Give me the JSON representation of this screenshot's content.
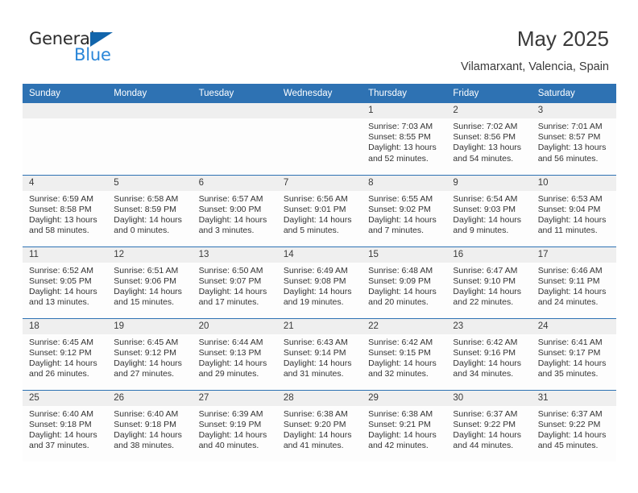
{
  "brand": {
    "name_top": "General",
    "name_bottom": "Blue",
    "triangle_color": "#1265ab",
    "blue_text_color": "#2a86d8"
  },
  "header": {
    "month_title": "May 2025",
    "location": "Vilamarxant, Valencia, Spain"
  },
  "theme": {
    "header_bar_color": "#2e72b3",
    "daynum_band_color": "#efefef",
    "row_divider_color": "#2e72b3"
  },
  "weekday_headers": [
    "Sunday",
    "Monday",
    "Tuesday",
    "Wednesday",
    "Thursday",
    "Friday",
    "Saturday"
  ],
  "weeks": [
    [
      {
        "day": "",
        "sunrise": "",
        "sunset": "",
        "daylight1": "",
        "daylight2": ""
      },
      {
        "day": "",
        "sunrise": "",
        "sunset": "",
        "daylight1": "",
        "daylight2": ""
      },
      {
        "day": "",
        "sunrise": "",
        "sunset": "",
        "daylight1": "",
        "daylight2": ""
      },
      {
        "day": "",
        "sunrise": "",
        "sunset": "",
        "daylight1": "",
        "daylight2": ""
      },
      {
        "day": "1",
        "sunrise": "Sunrise: 7:03 AM",
        "sunset": "Sunset: 8:55 PM",
        "daylight1": "Daylight: 13 hours",
        "daylight2": "and 52 minutes."
      },
      {
        "day": "2",
        "sunrise": "Sunrise: 7:02 AM",
        "sunset": "Sunset: 8:56 PM",
        "daylight1": "Daylight: 13 hours",
        "daylight2": "and 54 minutes."
      },
      {
        "day": "3",
        "sunrise": "Sunrise: 7:01 AM",
        "sunset": "Sunset: 8:57 PM",
        "daylight1": "Daylight: 13 hours",
        "daylight2": "and 56 minutes."
      }
    ],
    [
      {
        "day": "4",
        "sunrise": "Sunrise: 6:59 AM",
        "sunset": "Sunset: 8:58 PM",
        "daylight1": "Daylight: 13 hours",
        "daylight2": "and 58 minutes."
      },
      {
        "day": "5",
        "sunrise": "Sunrise: 6:58 AM",
        "sunset": "Sunset: 8:59 PM",
        "daylight1": "Daylight: 14 hours",
        "daylight2": "and 0 minutes."
      },
      {
        "day": "6",
        "sunrise": "Sunrise: 6:57 AM",
        "sunset": "Sunset: 9:00 PM",
        "daylight1": "Daylight: 14 hours",
        "daylight2": "and 3 minutes."
      },
      {
        "day": "7",
        "sunrise": "Sunrise: 6:56 AM",
        "sunset": "Sunset: 9:01 PM",
        "daylight1": "Daylight: 14 hours",
        "daylight2": "and 5 minutes."
      },
      {
        "day": "8",
        "sunrise": "Sunrise: 6:55 AM",
        "sunset": "Sunset: 9:02 PM",
        "daylight1": "Daylight: 14 hours",
        "daylight2": "and 7 minutes."
      },
      {
        "day": "9",
        "sunrise": "Sunrise: 6:54 AM",
        "sunset": "Sunset: 9:03 PM",
        "daylight1": "Daylight: 14 hours",
        "daylight2": "and 9 minutes."
      },
      {
        "day": "10",
        "sunrise": "Sunrise: 6:53 AM",
        "sunset": "Sunset: 9:04 PM",
        "daylight1": "Daylight: 14 hours",
        "daylight2": "and 11 minutes."
      }
    ],
    [
      {
        "day": "11",
        "sunrise": "Sunrise: 6:52 AM",
        "sunset": "Sunset: 9:05 PM",
        "daylight1": "Daylight: 14 hours",
        "daylight2": "and 13 minutes."
      },
      {
        "day": "12",
        "sunrise": "Sunrise: 6:51 AM",
        "sunset": "Sunset: 9:06 PM",
        "daylight1": "Daylight: 14 hours",
        "daylight2": "and 15 minutes."
      },
      {
        "day": "13",
        "sunrise": "Sunrise: 6:50 AM",
        "sunset": "Sunset: 9:07 PM",
        "daylight1": "Daylight: 14 hours",
        "daylight2": "and 17 minutes."
      },
      {
        "day": "14",
        "sunrise": "Sunrise: 6:49 AM",
        "sunset": "Sunset: 9:08 PM",
        "daylight1": "Daylight: 14 hours",
        "daylight2": "and 19 minutes."
      },
      {
        "day": "15",
        "sunrise": "Sunrise: 6:48 AM",
        "sunset": "Sunset: 9:09 PM",
        "daylight1": "Daylight: 14 hours",
        "daylight2": "and 20 minutes."
      },
      {
        "day": "16",
        "sunrise": "Sunrise: 6:47 AM",
        "sunset": "Sunset: 9:10 PM",
        "daylight1": "Daylight: 14 hours",
        "daylight2": "and 22 minutes."
      },
      {
        "day": "17",
        "sunrise": "Sunrise: 6:46 AM",
        "sunset": "Sunset: 9:11 PM",
        "daylight1": "Daylight: 14 hours",
        "daylight2": "and 24 minutes."
      }
    ],
    [
      {
        "day": "18",
        "sunrise": "Sunrise: 6:45 AM",
        "sunset": "Sunset: 9:12 PM",
        "daylight1": "Daylight: 14 hours",
        "daylight2": "and 26 minutes."
      },
      {
        "day": "19",
        "sunrise": "Sunrise: 6:45 AM",
        "sunset": "Sunset: 9:12 PM",
        "daylight1": "Daylight: 14 hours",
        "daylight2": "and 27 minutes."
      },
      {
        "day": "20",
        "sunrise": "Sunrise: 6:44 AM",
        "sunset": "Sunset: 9:13 PM",
        "daylight1": "Daylight: 14 hours",
        "daylight2": "and 29 minutes."
      },
      {
        "day": "21",
        "sunrise": "Sunrise: 6:43 AM",
        "sunset": "Sunset: 9:14 PM",
        "daylight1": "Daylight: 14 hours",
        "daylight2": "and 31 minutes."
      },
      {
        "day": "22",
        "sunrise": "Sunrise: 6:42 AM",
        "sunset": "Sunset: 9:15 PM",
        "daylight1": "Daylight: 14 hours",
        "daylight2": "and 32 minutes."
      },
      {
        "day": "23",
        "sunrise": "Sunrise: 6:42 AM",
        "sunset": "Sunset: 9:16 PM",
        "daylight1": "Daylight: 14 hours",
        "daylight2": "and 34 minutes."
      },
      {
        "day": "24",
        "sunrise": "Sunrise: 6:41 AM",
        "sunset": "Sunset: 9:17 PM",
        "daylight1": "Daylight: 14 hours",
        "daylight2": "and 35 minutes."
      }
    ],
    [
      {
        "day": "25",
        "sunrise": "Sunrise: 6:40 AM",
        "sunset": "Sunset: 9:18 PM",
        "daylight1": "Daylight: 14 hours",
        "daylight2": "and 37 minutes."
      },
      {
        "day": "26",
        "sunrise": "Sunrise: 6:40 AM",
        "sunset": "Sunset: 9:18 PM",
        "daylight1": "Daylight: 14 hours",
        "daylight2": "and 38 minutes."
      },
      {
        "day": "27",
        "sunrise": "Sunrise: 6:39 AM",
        "sunset": "Sunset: 9:19 PM",
        "daylight1": "Daylight: 14 hours",
        "daylight2": "and 40 minutes."
      },
      {
        "day": "28",
        "sunrise": "Sunrise: 6:38 AM",
        "sunset": "Sunset: 9:20 PM",
        "daylight1": "Daylight: 14 hours",
        "daylight2": "and 41 minutes."
      },
      {
        "day": "29",
        "sunrise": "Sunrise: 6:38 AM",
        "sunset": "Sunset: 9:21 PM",
        "daylight1": "Daylight: 14 hours",
        "daylight2": "and 42 minutes."
      },
      {
        "day": "30",
        "sunrise": "Sunrise: 6:37 AM",
        "sunset": "Sunset: 9:22 PM",
        "daylight1": "Daylight: 14 hours",
        "daylight2": "and 44 minutes."
      },
      {
        "day": "31",
        "sunrise": "Sunrise: 6:37 AM",
        "sunset": "Sunset: 9:22 PM",
        "daylight1": "Daylight: 14 hours",
        "daylight2": "and 45 minutes."
      }
    ]
  ]
}
